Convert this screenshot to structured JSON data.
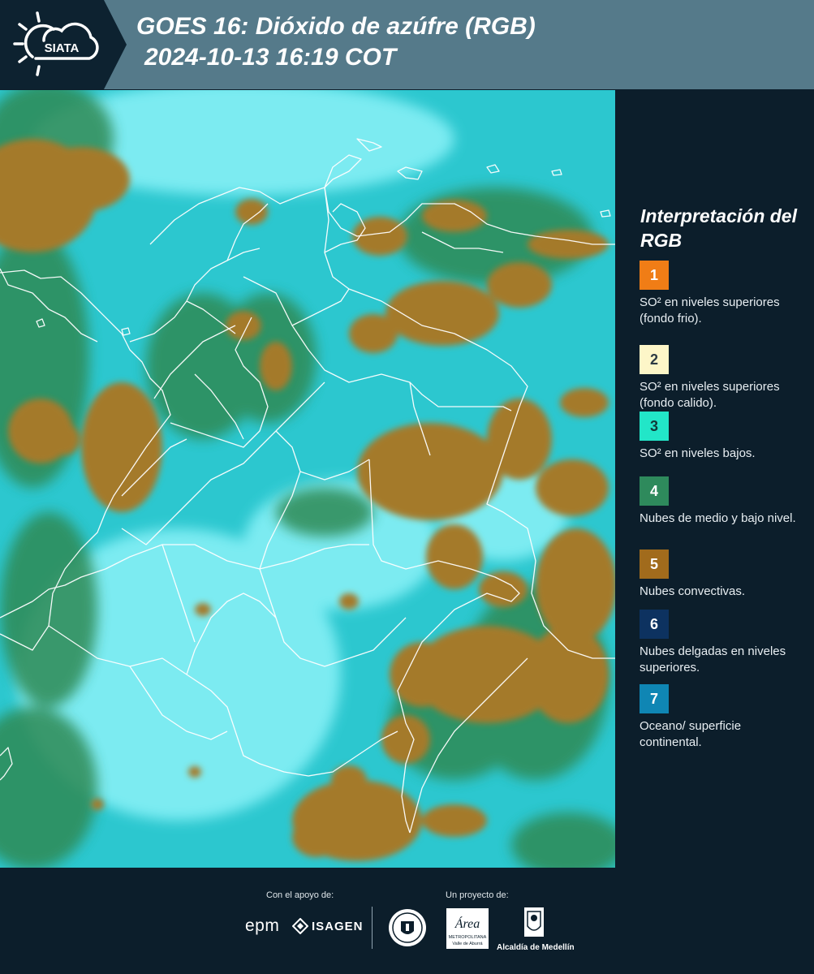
{
  "header": {
    "logo_text": "SIATA",
    "title_line1": "GOES 16: Dióxido de azúfre (RGB)",
    "title_line2": "2024-10-13 16:19 COT"
  },
  "map": {
    "icon": "satellite-rgb-map",
    "colors": {
      "background": "#2cc7cf",
      "clear": "#8af2f8",
      "low_cloud": "#2f8a55",
      "convective": "#a47a2c",
      "border": "#ffffff"
    }
  },
  "legend": {
    "title": "Interpretación del RGB",
    "items": [
      {
        "number": "1",
        "color": "#f07d16",
        "text_color": "#ffffff",
        "label": "SO² en niveles superiores (fondo frio)."
      },
      {
        "number": "2",
        "color": "#fdf6c8",
        "text_color": "#2c3a44",
        "label": "SO² en niveles superiores (fondo calido)."
      },
      {
        "number": "3",
        "color": "#22e6c8",
        "text_color": "#123a38",
        "label": "SO² en niveles bajos."
      },
      {
        "number": "4",
        "color": "#2e8a5c",
        "text_color": "#ffffff",
        "label": "Nubes de medio y bajo nivel."
      },
      {
        "number": "5",
        "color": "#a16b1c",
        "text_color": "#ffffff",
        "label": "Nubes convectivas."
      },
      {
        "number": "6",
        "color": "#0d3260",
        "text_color": "#ffffff",
        "label": "Nubes delgadas en niveles superiores."
      },
      {
        "number": "7",
        "color": "#0f86b4",
        "text_color": "#ffffff",
        "label": "Oceano/ superficie continental."
      }
    ]
  },
  "footer": {
    "support_label": "Con el apoyo de:",
    "project_label": "Un proyecto de:",
    "epm": "epm",
    "isagen": "ISAGEN",
    "area_logo_text": "Área",
    "area_sub1": "METROPOLITANA",
    "area_sub2": "Valle de Aburrá",
    "alcaldia": "Alcaldía de Medellín"
  }
}
